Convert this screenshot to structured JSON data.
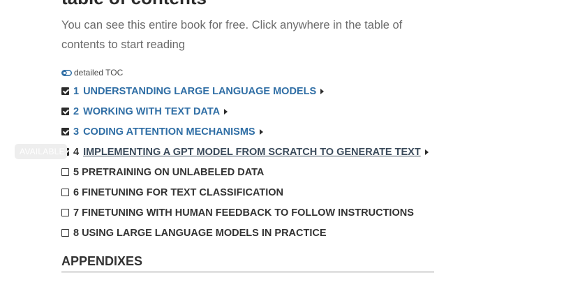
{
  "toc": {
    "heading": "table of contents",
    "intro": "You can see this entire book for free. Click anywhere in the table of contents to start reading",
    "toggle_label": "detailed TOC",
    "badge": "AVAILABLE",
    "appendixes": "APPENDIXES"
  },
  "chapters": [
    {
      "num": "1",
      "title": "UNDERSTANDING LARGE LANGUAGE MODELS",
      "checked": true,
      "available": true
    },
    {
      "num": "2",
      "title": "WORKING WITH TEXT DATA",
      "checked": true,
      "available": true
    },
    {
      "num": "3",
      "title": "CODING ATTENTION MECHANISMS",
      "checked": true,
      "available": true
    },
    {
      "num": "4",
      "title": "IMPLEMENTING A GPT MODEL FROM SCRATCH TO GENERATE TEXT",
      "checked": true,
      "available": true
    },
    {
      "num": "5",
      "title": "PRETRAINING ON UNLABELED DATA",
      "checked": false,
      "available": false
    },
    {
      "num": "6",
      "title": "FINETUNING FOR TEXT CLASSIFICATION",
      "checked": false,
      "available": false
    },
    {
      "num": "7",
      "title": "FINETUNING WITH HUMAN FEEDBACK TO FOLLOW INSTRUCTIONS",
      "checked": false,
      "available": false
    },
    {
      "num": "8",
      "title": "USING LARGE LANGUAGE MODELS IN PRACTICE",
      "checked": false,
      "available": false
    }
  ],
  "colors": {
    "link": "#2f6ea5",
    "text": "#333333",
    "muted": "#6b6b6b"
  },
  "icons": {
    "toggle": "toggle-switch-icon",
    "checkbox": "checkbox-icon",
    "expand": "caret-right-icon"
  }
}
